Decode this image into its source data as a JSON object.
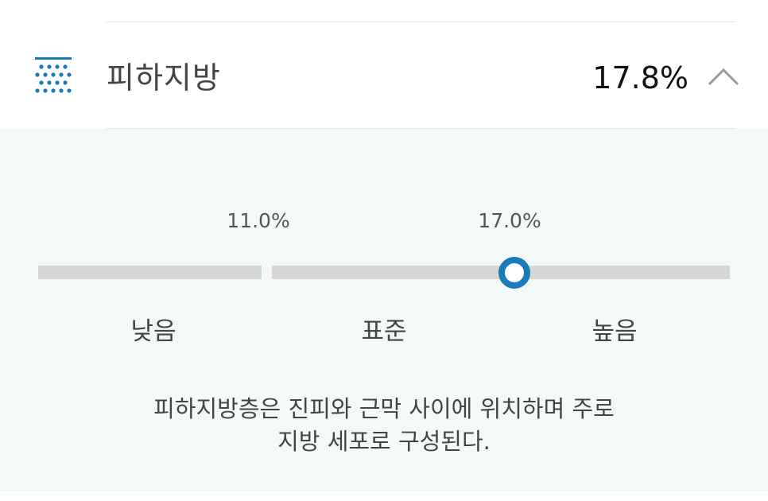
{
  "header": {
    "icon": "subcutaneous-fat-icon",
    "title": "피하지방",
    "value": "17.8%",
    "toggle_icon": "chevron-up-icon"
  },
  "gauge": {
    "thresholds": [
      "11.0%",
      "17.0%"
    ],
    "levels": [
      "낮음",
      "표준",
      "높음"
    ],
    "current_value": 17.8,
    "marker_color": "#1a7bb9"
  },
  "description": {
    "line1": "피하지방층은 진피와 근막 사이에 위치하며 주로",
    "line2": "지방 세포로 구성된다."
  },
  "colors": {
    "accent": "#1a7bb9",
    "panel_bg": "#f3f9f9",
    "bar": "#d6d6d6"
  }
}
